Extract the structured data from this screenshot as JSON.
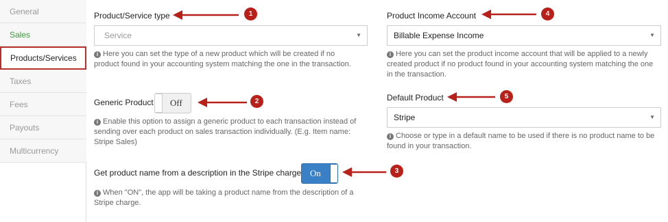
{
  "sidebar": {
    "items": [
      {
        "label": "General"
      },
      {
        "label": "Sales"
      },
      {
        "label": "Products/Services"
      },
      {
        "label": "Taxes"
      },
      {
        "label": "Fees"
      },
      {
        "label": "Payouts"
      },
      {
        "label": "Multicurrency"
      }
    ]
  },
  "product_type": {
    "label": "Product/Service type",
    "value": "Service",
    "help": "Here you can set the type of a new product which will be created if no product found in your accounting system matching the one in the transaction."
  },
  "generic_product": {
    "label": "Generic Product",
    "toggle": "Off",
    "help": "Enable this option to assign a generic product to each transaction instead of sending over each product on sales transaction individually. (E.g. Item name: Stripe Sales)"
  },
  "product_name_from_description": {
    "label": "Get product name from a description in the Stripe charge",
    "toggle": "On",
    "help": "When \"ON\", the app will be taking a product name from the description of a Stripe charge."
  },
  "income_account": {
    "label": "Product Income Account",
    "value": "Billable Expense Income",
    "help": "Here you can set the product income account that will be applied to a newly created product if no product found in your accounting system matching the one in the transaction."
  },
  "default_product": {
    "label": "Default Product",
    "value": "Stripe",
    "help": "Choose or type in a default name to be used if there is no product name to be found in your transaction."
  },
  "callouts": [
    "1",
    "2",
    "3",
    "4",
    "5"
  ],
  "colors": {
    "accent_red": "#b8211a",
    "toggle_on": "#3a80c7",
    "sales_green": "#3a9a3a"
  },
  "icons": {
    "info": "info-circle-icon",
    "caret": "caret-down-icon"
  }
}
